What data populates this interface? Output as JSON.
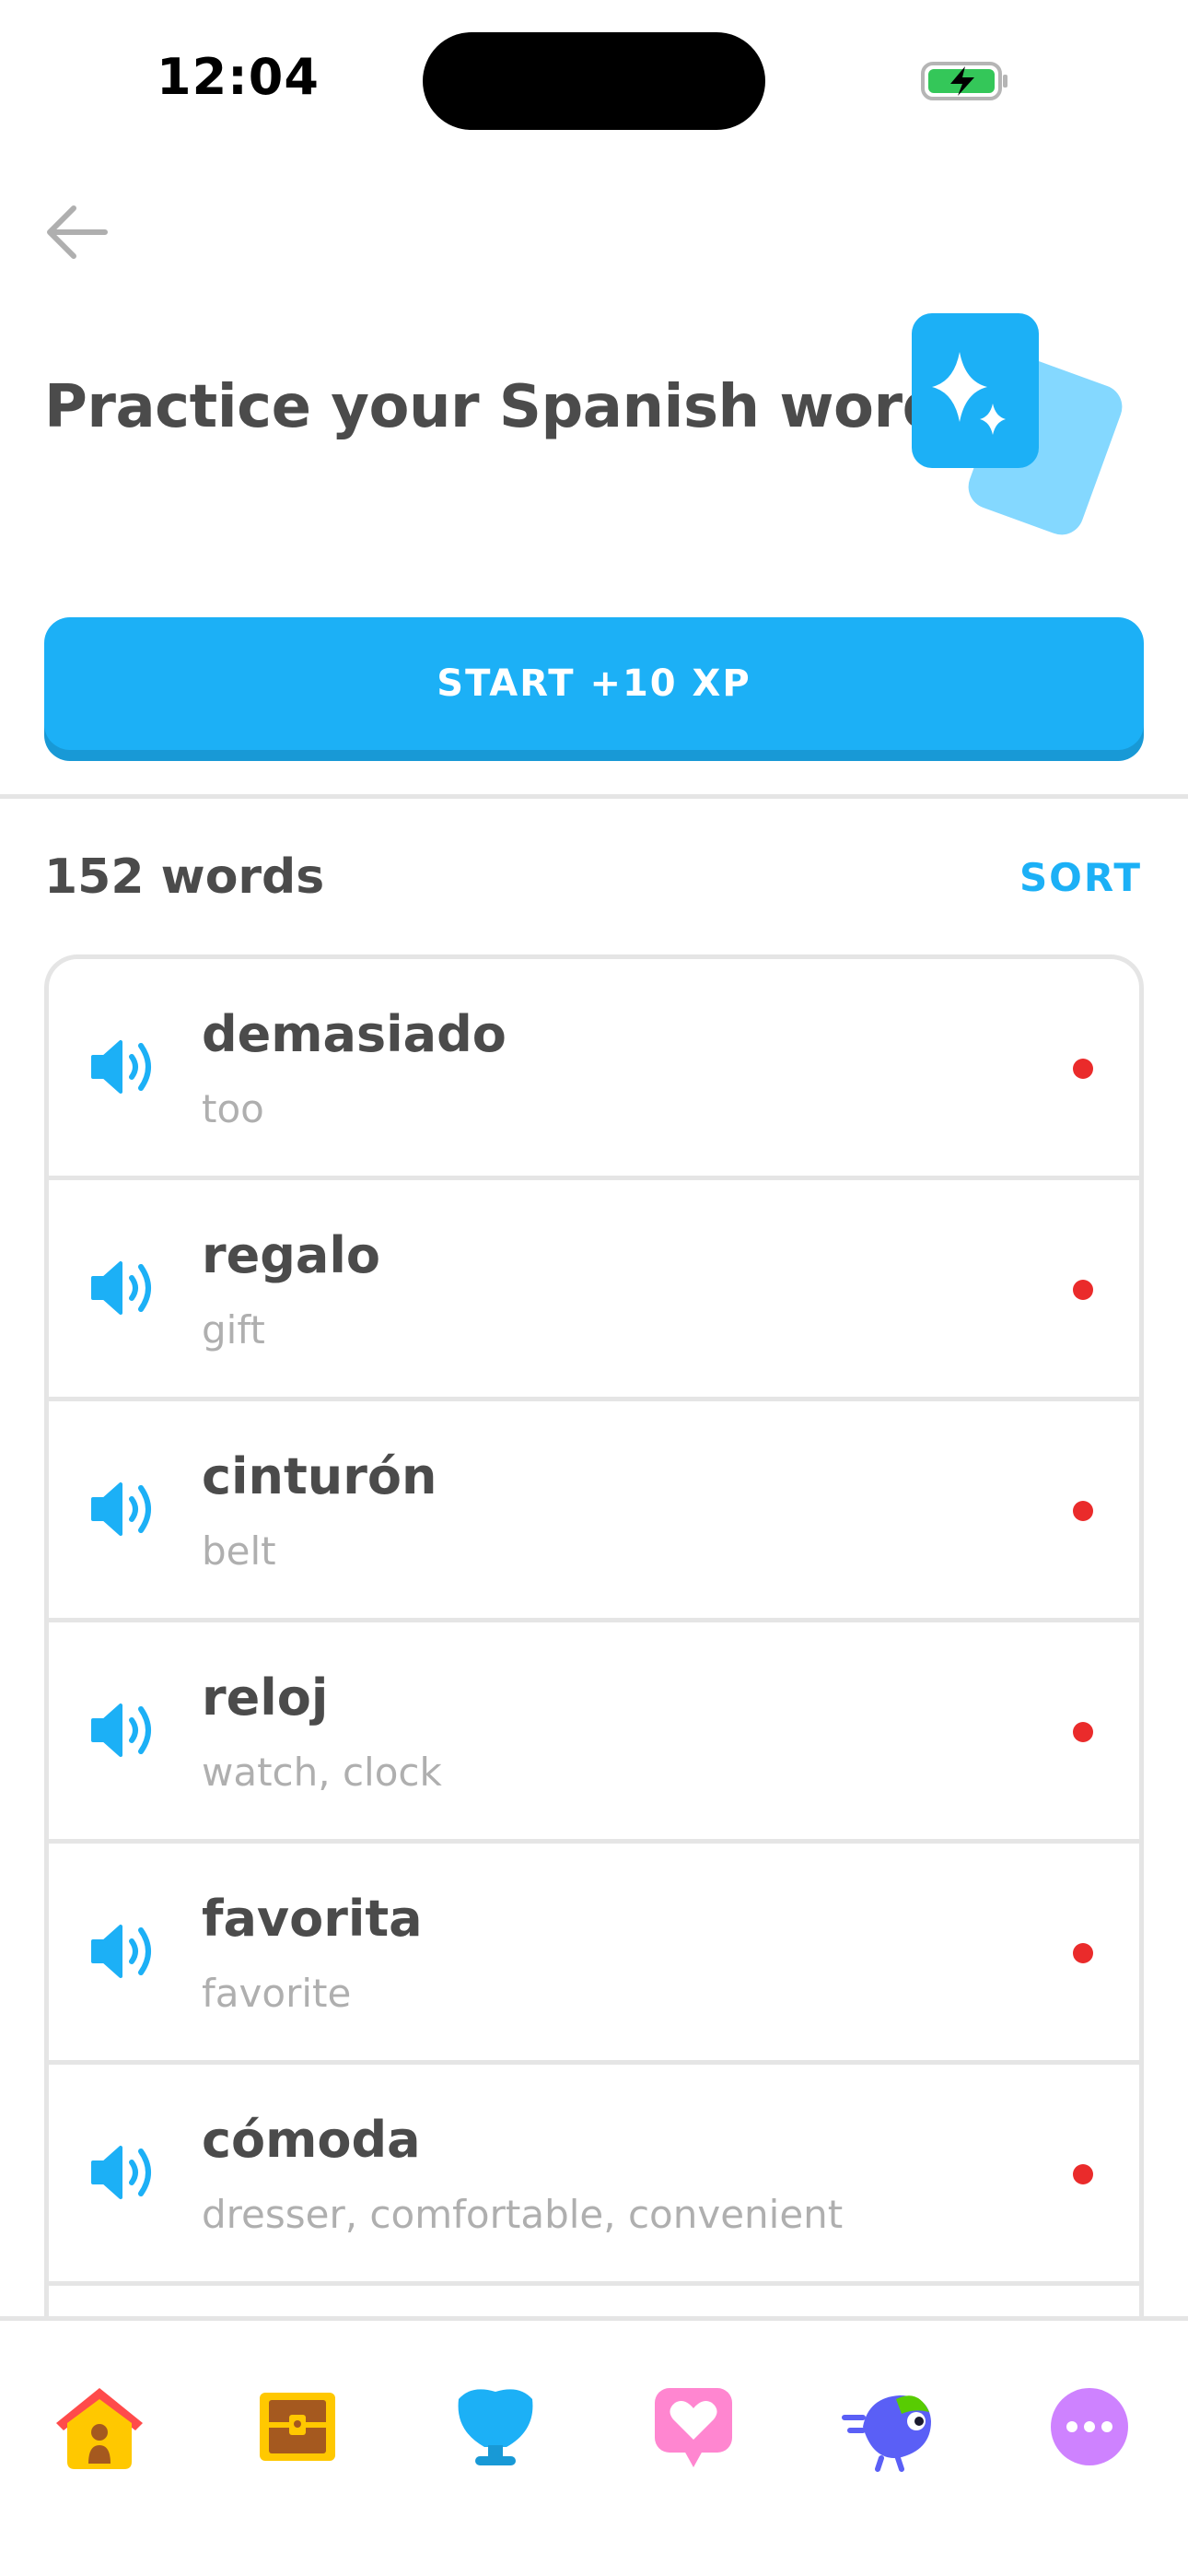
{
  "status_bar": {
    "time": "12:04"
  },
  "header": {
    "title": "Practice your Spanish words"
  },
  "start_button": {
    "label": "START +10 XP"
  },
  "words": {
    "count_label": "152 words",
    "sort_label": "SORT",
    "items": [
      {
        "word": "demasiado",
        "translation": "too"
      },
      {
        "word": "regalo",
        "translation": "gift"
      },
      {
        "word": "cinturón",
        "translation": "belt"
      },
      {
        "word": "reloj",
        "translation": "watch, clock"
      },
      {
        "word": "favorita",
        "translation": "favorite"
      },
      {
        "word": "cómoda",
        "translation": "dresser, comfortable, convenient"
      }
    ]
  },
  "colors": {
    "accent": "#1cb0f6",
    "accent_shadow": "#1899d6",
    "text_primary": "#4b4b4b",
    "text_secondary": "#afafaf",
    "status_dot": "#ea2b2b",
    "divider": "#e5e5e5"
  },
  "icons": {
    "back": "back-arrow-icon",
    "hero": "practice-cards-icon",
    "speaker": "speaker-icon",
    "nav": [
      "home-icon",
      "treasure-chest-icon",
      "shield-icon",
      "heart-chat-icon",
      "bird-icon",
      "more-icon"
    ]
  }
}
